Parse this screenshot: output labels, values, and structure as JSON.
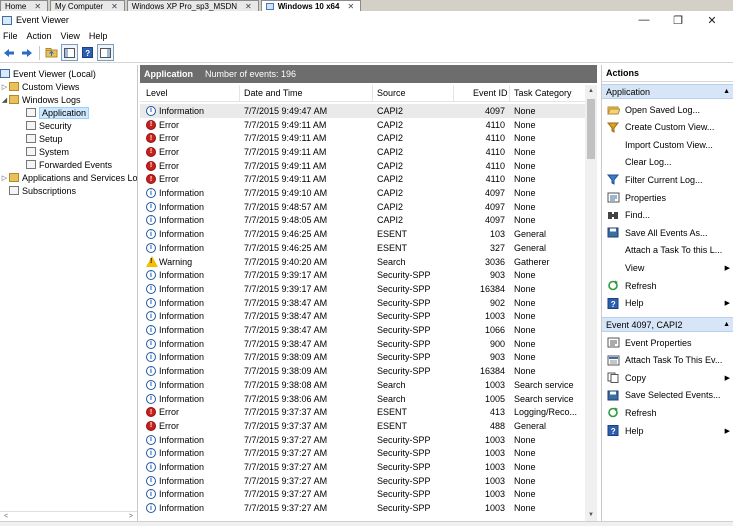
{
  "vm_tabs": [
    {
      "label": "Home",
      "active": false
    },
    {
      "label": "My Computer",
      "active": false
    },
    {
      "label": "Windows XP Pro_sp3_MSDN",
      "active": false
    },
    {
      "label": "Windows 10 x64",
      "active": true
    }
  ],
  "window": {
    "title": "Event Viewer",
    "minimize": "—",
    "maximize": "❐",
    "close": "✕"
  },
  "menu": [
    "File",
    "Action",
    "View",
    "Help"
  ],
  "tree": {
    "root": "Event Viewer (Local)",
    "custom_views": "Custom Views",
    "windows_logs": "Windows Logs",
    "logs": [
      "Application",
      "Security",
      "Setup",
      "System",
      "Forwarded Events"
    ],
    "apps_services": "Applications and Services Lo",
    "subscriptions": "Subscriptions"
  },
  "center": {
    "title": "Application",
    "count_label": "Number of events: 196",
    "columns": {
      "level": "Level",
      "datetime": "Date and Time",
      "source": "Source",
      "eventid": "Event ID",
      "category": "Task Category"
    },
    "rows": [
      {
        "level": "Information",
        "type": "info",
        "datetime": "7/7/2015 9:49:47 AM",
        "source": "CAPI2",
        "eventid": "4097",
        "category": "None"
      },
      {
        "level": "Error",
        "type": "error",
        "datetime": "7/7/2015 9:49:11 AM",
        "source": "CAPI2",
        "eventid": "4110",
        "category": "None"
      },
      {
        "level": "Error",
        "type": "error",
        "datetime": "7/7/2015 9:49:11 AM",
        "source": "CAPI2",
        "eventid": "4110",
        "category": "None"
      },
      {
        "level": "Error",
        "type": "error",
        "datetime": "7/7/2015 9:49:11 AM",
        "source": "CAPI2",
        "eventid": "4110",
        "category": "None"
      },
      {
        "level": "Error",
        "type": "error",
        "datetime": "7/7/2015 9:49:11 AM",
        "source": "CAPI2",
        "eventid": "4110",
        "category": "None"
      },
      {
        "level": "Error",
        "type": "error",
        "datetime": "7/7/2015 9:49:11 AM",
        "source": "CAPI2",
        "eventid": "4110",
        "category": "None"
      },
      {
        "level": "Information",
        "type": "info",
        "datetime": "7/7/2015 9:49:10 AM",
        "source": "CAPI2",
        "eventid": "4097",
        "category": "None"
      },
      {
        "level": "Information",
        "type": "info",
        "datetime": "7/7/2015 9:48:57 AM",
        "source": "CAPI2",
        "eventid": "4097",
        "category": "None"
      },
      {
        "level": "Information",
        "type": "info",
        "datetime": "7/7/2015 9:48:05 AM",
        "source": "CAPI2",
        "eventid": "4097",
        "category": "None"
      },
      {
        "level": "Information",
        "type": "info",
        "datetime": "7/7/2015 9:46:25 AM",
        "source": "ESENT",
        "eventid": "103",
        "category": "General"
      },
      {
        "level": "Information",
        "type": "info",
        "datetime": "7/7/2015 9:46:25 AM",
        "source": "ESENT",
        "eventid": "327",
        "category": "General"
      },
      {
        "level": "Warning",
        "type": "warn",
        "datetime": "7/7/2015 9:40:20 AM",
        "source": "Search",
        "eventid": "3036",
        "category": "Gatherer"
      },
      {
        "level": "Information",
        "type": "info",
        "datetime": "7/7/2015 9:39:17 AM",
        "source": "Security-SPP",
        "eventid": "903",
        "category": "None"
      },
      {
        "level": "Information",
        "type": "info",
        "datetime": "7/7/2015 9:39:17 AM",
        "source": "Security-SPP",
        "eventid": "16384",
        "category": "None"
      },
      {
        "level": "Information",
        "type": "info",
        "datetime": "7/7/2015 9:38:47 AM",
        "source": "Security-SPP",
        "eventid": "902",
        "category": "None"
      },
      {
        "level": "Information",
        "type": "info",
        "datetime": "7/7/2015 9:38:47 AM",
        "source": "Security-SPP",
        "eventid": "1003",
        "category": "None"
      },
      {
        "level": "Information",
        "type": "info",
        "datetime": "7/7/2015 9:38:47 AM",
        "source": "Security-SPP",
        "eventid": "1066",
        "category": "None"
      },
      {
        "level": "Information",
        "type": "info",
        "datetime": "7/7/2015 9:38:47 AM",
        "source": "Security-SPP",
        "eventid": "900",
        "category": "None"
      },
      {
        "level": "Information",
        "type": "info",
        "datetime": "7/7/2015 9:38:09 AM",
        "source": "Security-SPP",
        "eventid": "903",
        "category": "None"
      },
      {
        "level": "Information",
        "type": "info",
        "datetime": "7/7/2015 9:38:09 AM",
        "source": "Security-SPP",
        "eventid": "16384",
        "category": "None"
      },
      {
        "level": "Information",
        "type": "info",
        "datetime": "7/7/2015 9:38:08 AM",
        "source": "Search",
        "eventid": "1003",
        "category": "Search service"
      },
      {
        "level": "Information",
        "type": "info",
        "datetime": "7/7/2015 9:38:06 AM",
        "source": "Search",
        "eventid": "1005",
        "category": "Search service"
      },
      {
        "level": "Error",
        "type": "error",
        "datetime": "7/7/2015 9:37:37 AM",
        "source": "ESENT",
        "eventid": "413",
        "category": "Logging/Reco..."
      },
      {
        "level": "Error",
        "type": "error",
        "datetime": "7/7/2015 9:37:37 AM",
        "source": "ESENT",
        "eventid": "488",
        "category": "General"
      },
      {
        "level": "Information",
        "type": "info",
        "datetime": "7/7/2015 9:37:27 AM",
        "source": "Security-SPP",
        "eventid": "1003",
        "category": "None"
      },
      {
        "level": "Information",
        "type": "info",
        "datetime": "7/7/2015 9:37:27 AM",
        "source": "Security-SPP",
        "eventid": "1003",
        "category": "None"
      },
      {
        "level": "Information",
        "type": "info",
        "datetime": "7/7/2015 9:37:27 AM",
        "source": "Security-SPP",
        "eventid": "1003",
        "category": "None"
      },
      {
        "level": "Information",
        "type": "info",
        "datetime": "7/7/2015 9:37:27 AM",
        "source": "Security-SPP",
        "eventid": "1003",
        "category": "None"
      },
      {
        "level": "Information",
        "type": "info",
        "datetime": "7/7/2015 9:37:27 AM",
        "source": "Security-SPP",
        "eventid": "1003",
        "category": "None"
      },
      {
        "level": "Information",
        "type": "info",
        "datetime": "7/7/2015 9:37:27 AM",
        "source": "Security-SPP",
        "eventid": "1003",
        "category": "None"
      }
    ]
  },
  "actions": {
    "title": "Actions",
    "section1": "Application",
    "items1": [
      {
        "label": "Open Saved Log...",
        "icon": "folder-open-icon",
        "submenu": false
      },
      {
        "label": "Create Custom View...",
        "icon": "filter-create-icon",
        "submenu": false
      },
      {
        "label": "Import Custom View...",
        "icon": "",
        "submenu": false
      },
      {
        "label": "Clear Log...",
        "icon": "",
        "submenu": false
      },
      {
        "label": "Filter Current Log...",
        "icon": "filter-icon",
        "submenu": false
      },
      {
        "label": "Properties",
        "icon": "properties-icon",
        "submenu": false
      },
      {
        "label": "Find...",
        "icon": "find-icon",
        "submenu": false
      },
      {
        "label": "Save All Events As...",
        "icon": "save-icon",
        "submenu": false
      },
      {
        "label": "Attach a Task To this L...",
        "icon": "",
        "submenu": false
      },
      {
        "label": "View",
        "icon": "",
        "submenu": true
      },
      {
        "label": "Refresh",
        "icon": "refresh-icon",
        "submenu": false
      },
      {
        "label": "Help",
        "icon": "help-icon",
        "submenu": true
      }
    ],
    "section2": "Event 4097, CAPI2",
    "items2": [
      {
        "label": "Event Properties",
        "icon": "event-properties-icon",
        "submenu": false
      },
      {
        "label": "Attach Task To This Ev...",
        "icon": "task-icon",
        "submenu": false
      },
      {
        "label": "Copy",
        "icon": "copy-icon",
        "submenu": true
      },
      {
        "label": "Save Selected Events...",
        "icon": "save-icon",
        "submenu": false
      },
      {
        "label": "Refresh",
        "icon": "refresh-icon",
        "submenu": false
      },
      {
        "label": "Help",
        "icon": "help-icon",
        "submenu": true
      }
    ]
  }
}
